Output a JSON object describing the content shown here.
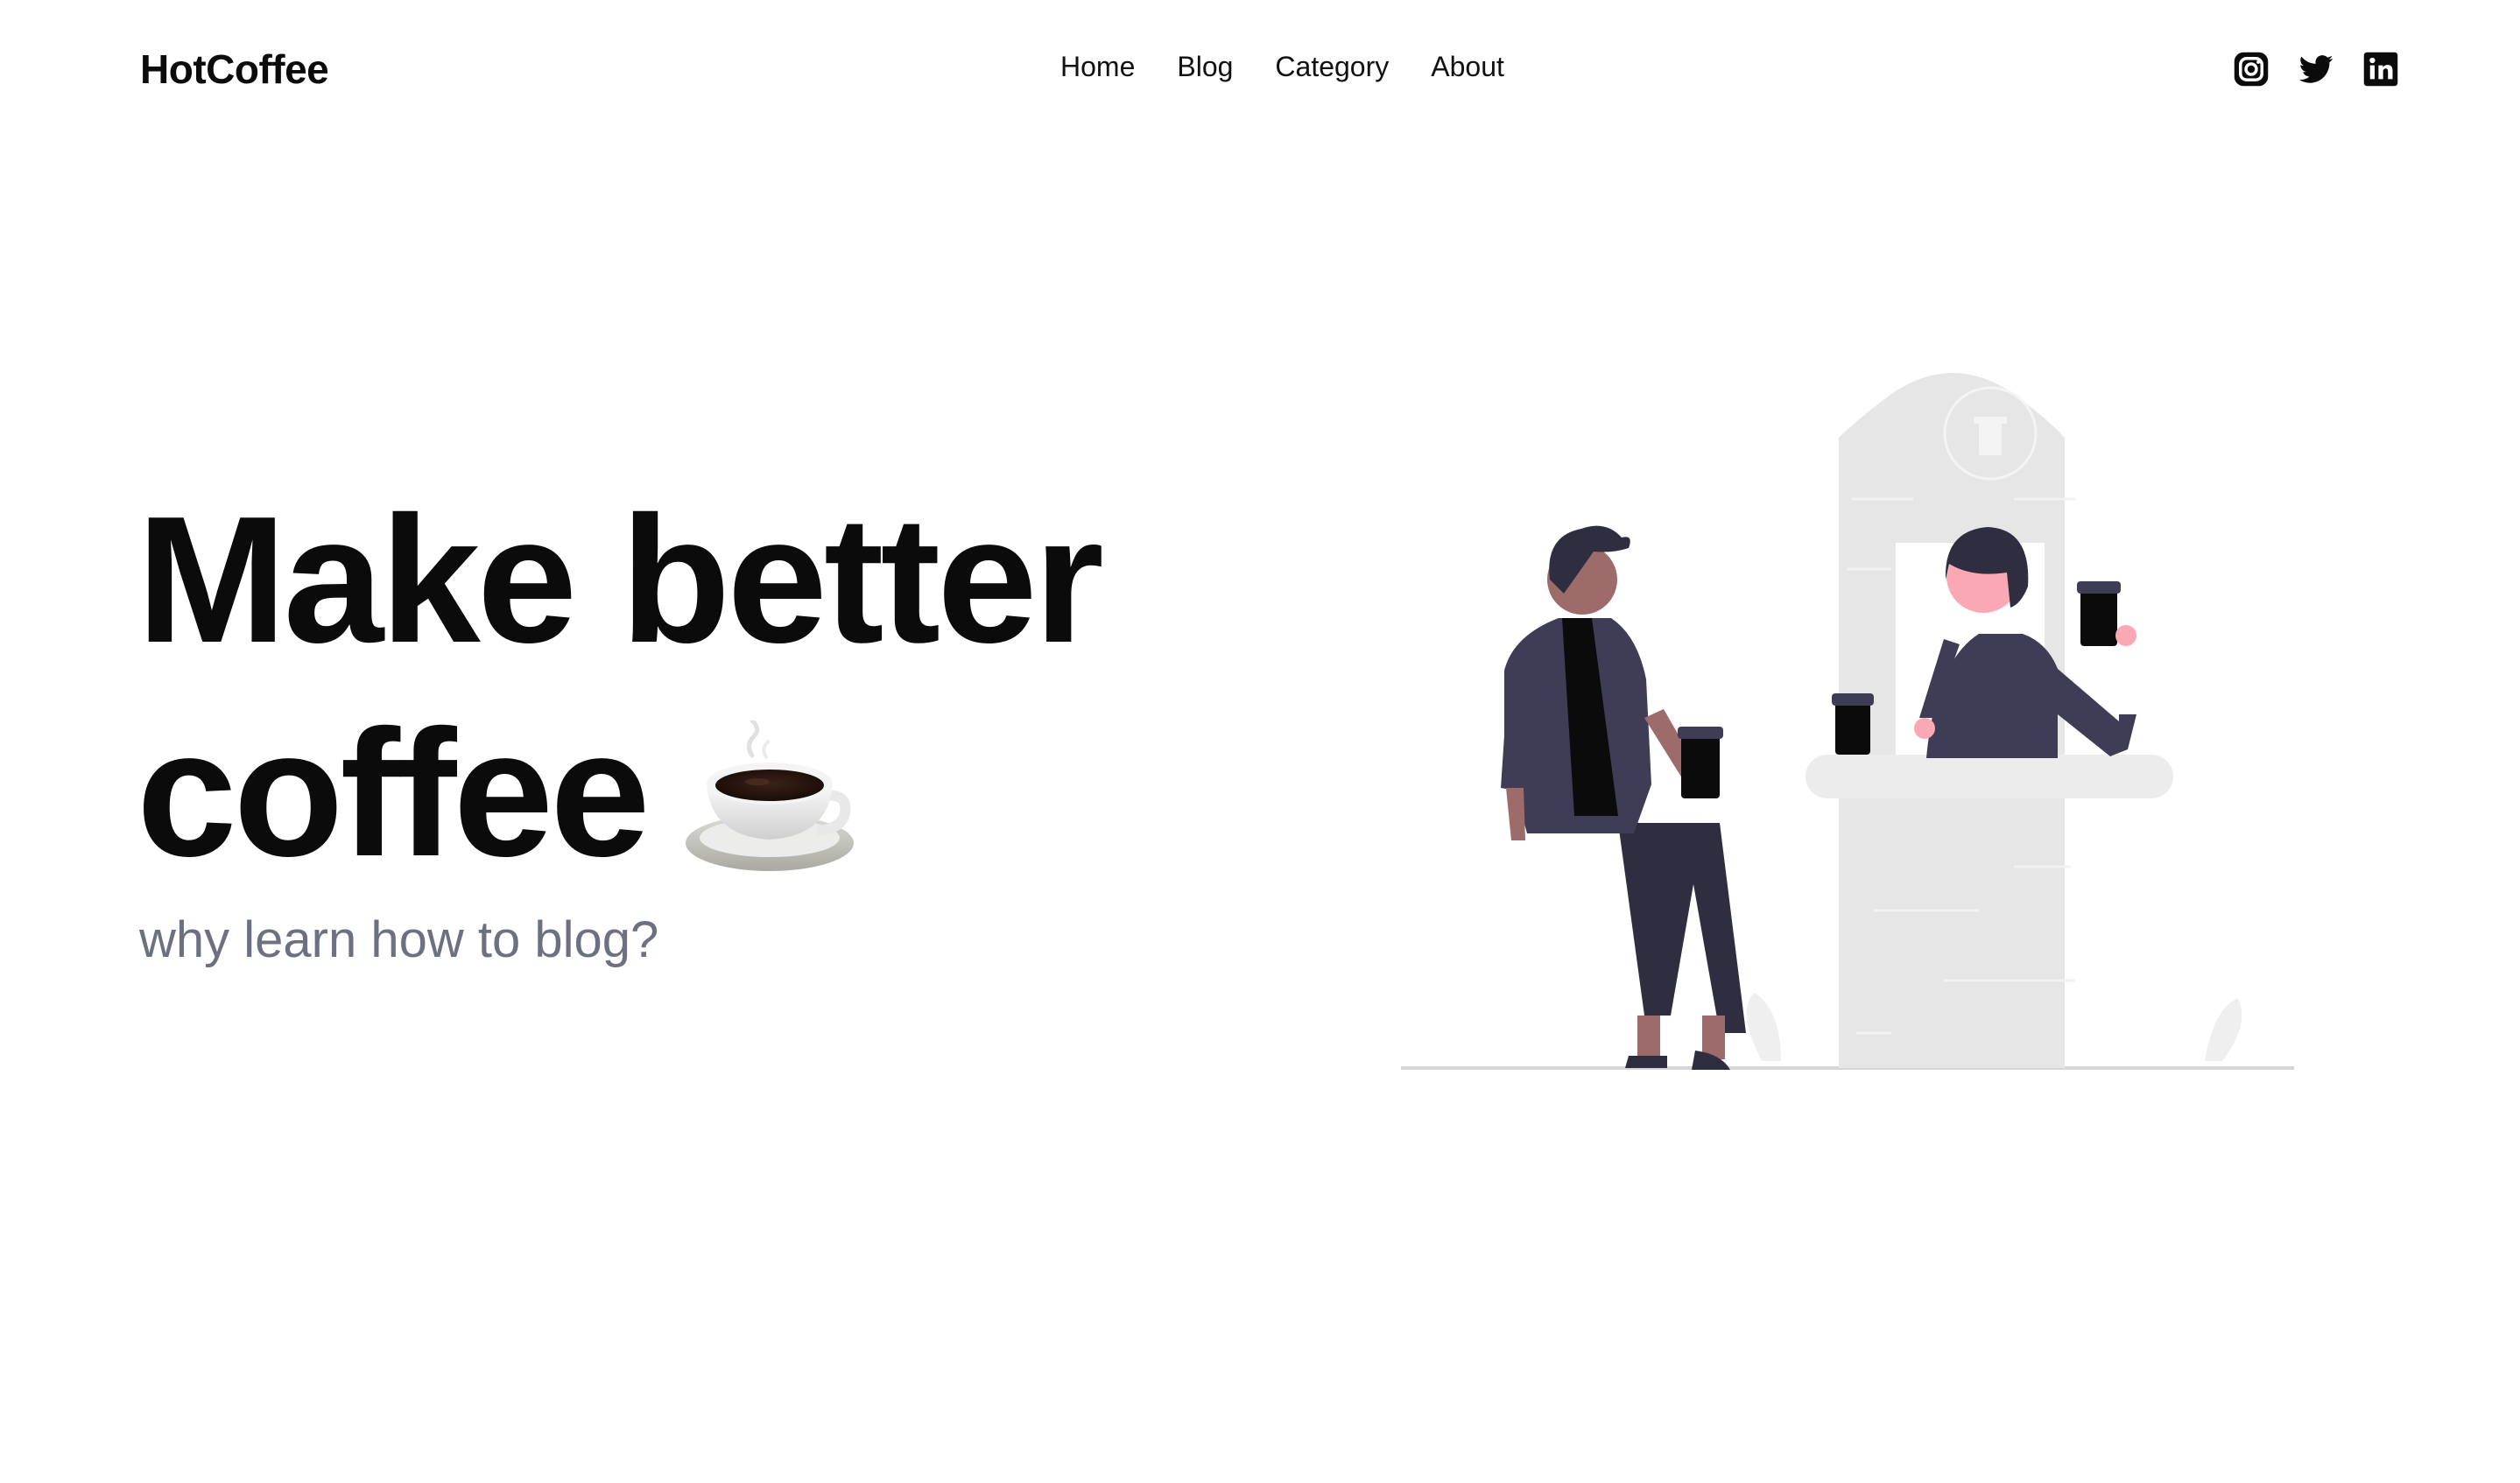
{
  "brand": {
    "name": "HotCoffee"
  },
  "nav": {
    "items": [
      {
        "label": "Home"
      },
      {
        "label": "Blog"
      },
      {
        "label": "Category"
      },
      {
        "label": "About"
      }
    ]
  },
  "social": {
    "icons": [
      "instagram-icon",
      "twitter-icon",
      "linkedin-icon"
    ]
  },
  "hero": {
    "title_line1": "Make better",
    "title_line2": "coffee",
    "emoji_name": "coffee-cup-icon",
    "subtitle": "why learn how to blog?"
  },
  "colors": {
    "text": "#0b0b0b",
    "subtitle": "#6b7180",
    "figure_dark": "#3f3d56",
    "skin_tan": "#9e6b6b",
    "skin_pink": "#f9a8b4",
    "booth_gray": "#e6e6e6"
  }
}
